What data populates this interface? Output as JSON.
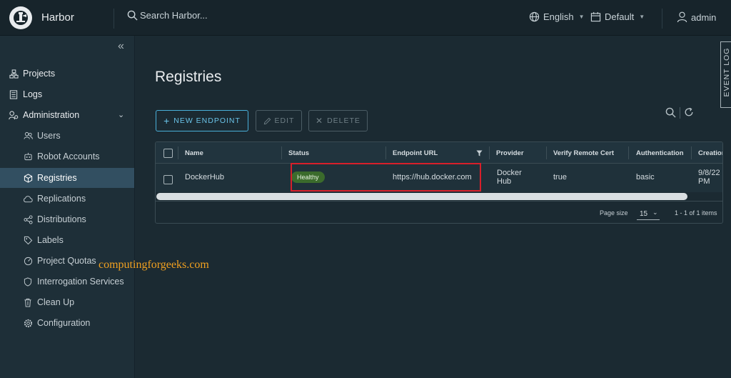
{
  "header": {
    "brand": "Harbor",
    "search_placeholder": "Search Harbor...",
    "language": "English",
    "theme": "Default",
    "user": "admin"
  },
  "sidebar": {
    "items": [
      {
        "label": "Projects",
        "icon": "projects-icon"
      },
      {
        "label": "Logs",
        "icon": "logs-icon"
      },
      {
        "label": "Administration",
        "icon": "administration-icon"
      }
    ],
    "admin_items": [
      {
        "label": "Users"
      },
      {
        "label": "Robot Accounts"
      },
      {
        "label": "Registries"
      },
      {
        "label": "Replications"
      },
      {
        "label": "Distributions"
      },
      {
        "label": "Labels"
      },
      {
        "label": "Project Quotas"
      },
      {
        "label": "Interrogation Services"
      },
      {
        "label": "Clean Up"
      },
      {
        "label": "Configuration"
      }
    ],
    "active": "Registries"
  },
  "main": {
    "title": "Registries",
    "buttons": {
      "new_endpoint": "NEW ENDPOINT",
      "edit": "EDIT",
      "delete": "DELETE"
    },
    "event_log": "EVENT LOG",
    "table": {
      "columns": [
        "Name",
        "Status",
        "Endpoint URL",
        "Provider",
        "Verify Remote Cert",
        "Authentication",
        "Creation"
      ],
      "rows": [
        {
          "name": "DockerHub",
          "status": "Healthy",
          "endpoint_url": "https://hub.docker.com",
          "provider_line1": "Docker",
          "provider_line2": "Hub",
          "verify_remote_cert": "true",
          "authentication": "basic",
          "creation_line1": "9/8/22",
          "creation_line2": "PM"
        }
      ],
      "page_size_label": "Page size",
      "page_size": "15",
      "pagination": "1 - 1 of 1 items"
    }
  },
  "watermark": "computingforgeeks.com",
  "colors": {
    "accent": "#49afd9",
    "healthy": "#3b6b2c",
    "highlight": "#d81f2a"
  }
}
